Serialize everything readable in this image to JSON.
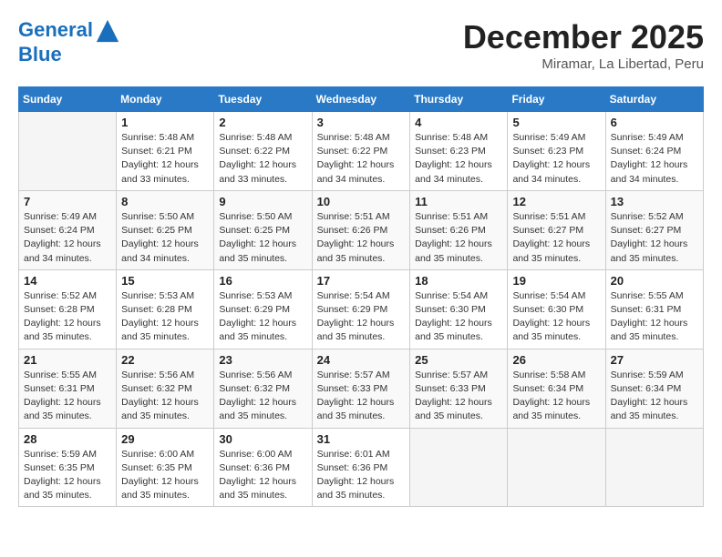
{
  "header": {
    "logo_line1": "General",
    "logo_line2": "Blue",
    "month": "December 2025",
    "location": "Miramar, La Libertad, Peru"
  },
  "weekdays": [
    "Sunday",
    "Monday",
    "Tuesday",
    "Wednesday",
    "Thursday",
    "Friday",
    "Saturday"
  ],
  "weeks": [
    [
      {
        "day": "",
        "empty": true
      },
      {
        "day": "1",
        "sunrise": "5:48 AM",
        "sunset": "6:21 PM",
        "daylight": "12 hours and 33 minutes."
      },
      {
        "day": "2",
        "sunrise": "5:48 AM",
        "sunset": "6:22 PM",
        "daylight": "12 hours and 33 minutes."
      },
      {
        "day": "3",
        "sunrise": "5:48 AM",
        "sunset": "6:22 PM",
        "daylight": "12 hours and 34 minutes."
      },
      {
        "day": "4",
        "sunrise": "5:48 AM",
        "sunset": "6:23 PM",
        "daylight": "12 hours and 34 minutes."
      },
      {
        "day": "5",
        "sunrise": "5:49 AM",
        "sunset": "6:23 PM",
        "daylight": "12 hours and 34 minutes."
      },
      {
        "day": "6",
        "sunrise": "5:49 AM",
        "sunset": "6:24 PM",
        "daylight": "12 hours and 34 minutes."
      }
    ],
    [
      {
        "day": "7",
        "sunrise": "5:49 AM",
        "sunset": "6:24 PM",
        "daylight": "12 hours and 34 minutes."
      },
      {
        "day": "8",
        "sunrise": "5:50 AM",
        "sunset": "6:25 PM",
        "daylight": "12 hours and 34 minutes."
      },
      {
        "day": "9",
        "sunrise": "5:50 AM",
        "sunset": "6:25 PM",
        "daylight": "12 hours and 35 minutes."
      },
      {
        "day": "10",
        "sunrise": "5:51 AM",
        "sunset": "6:26 PM",
        "daylight": "12 hours and 35 minutes."
      },
      {
        "day": "11",
        "sunrise": "5:51 AM",
        "sunset": "6:26 PM",
        "daylight": "12 hours and 35 minutes."
      },
      {
        "day": "12",
        "sunrise": "5:51 AM",
        "sunset": "6:27 PM",
        "daylight": "12 hours and 35 minutes."
      },
      {
        "day": "13",
        "sunrise": "5:52 AM",
        "sunset": "6:27 PM",
        "daylight": "12 hours and 35 minutes."
      }
    ],
    [
      {
        "day": "14",
        "sunrise": "5:52 AM",
        "sunset": "6:28 PM",
        "daylight": "12 hours and 35 minutes."
      },
      {
        "day": "15",
        "sunrise": "5:53 AM",
        "sunset": "6:28 PM",
        "daylight": "12 hours and 35 minutes."
      },
      {
        "day": "16",
        "sunrise": "5:53 AM",
        "sunset": "6:29 PM",
        "daylight": "12 hours and 35 minutes."
      },
      {
        "day": "17",
        "sunrise": "5:54 AM",
        "sunset": "6:29 PM",
        "daylight": "12 hours and 35 minutes."
      },
      {
        "day": "18",
        "sunrise": "5:54 AM",
        "sunset": "6:30 PM",
        "daylight": "12 hours and 35 minutes."
      },
      {
        "day": "19",
        "sunrise": "5:54 AM",
        "sunset": "6:30 PM",
        "daylight": "12 hours and 35 minutes."
      },
      {
        "day": "20",
        "sunrise": "5:55 AM",
        "sunset": "6:31 PM",
        "daylight": "12 hours and 35 minutes."
      }
    ],
    [
      {
        "day": "21",
        "sunrise": "5:55 AM",
        "sunset": "6:31 PM",
        "daylight": "12 hours and 35 minutes."
      },
      {
        "day": "22",
        "sunrise": "5:56 AM",
        "sunset": "6:32 PM",
        "daylight": "12 hours and 35 minutes."
      },
      {
        "day": "23",
        "sunrise": "5:56 AM",
        "sunset": "6:32 PM",
        "daylight": "12 hours and 35 minutes."
      },
      {
        "day": "24",
        "sunrise": "5:57 AM",
        "sunset": "6:33 PM",
        "daylight": "12 hours and 35 minutes."
      },
      {
        "day": "25",
        "sunrise": "5:57 AM",
        "sunset": "6:33 PM",
        "daylight": "12 hours and 35 minutes."
      },
      {
        "day": "26",
        "sunrise": "5:58 AM",
        "sunset": "6:34 PM",
        "daylight": "12 hours and 35 minutes."
      },
      {
        "day": "27",
        "sunrise": "5:59 AM",
        "sunset": "6:34 PM",
        "daylight": "12 hours and 35 minutes."
      }
    ],
    [
      {
        "day": "28",
        "sunrise": "5:59 AM",
        "sunset": "6:35 PM",
        "daylight": "12 hours and 35 minutes."
      },
      {
        "day": "29",
        "sunrise": "6:00 AM",
        "sunset": "6:35 PM",
        "daylight": "12 hours and 35 minutes."
      },
      {
        "day": "30",
        "sunrise": "6:00 AM",
        "sunset": "6:36 PM",
        "daylight": "12 hours and 35 minutes."
      },
      {
        "day": "31",
        "sunrise": "6:01 AM",
        "sunset": "6:36 PM",
        "daylight": "12 hours and 35 minutes."
      },
      {
        "day": "",
        "empty": true
      },
      {
        "day": "",
        "empty": true
      },
      {
        "day": "",
        "empty": true
      }
    ]
  ]
}
